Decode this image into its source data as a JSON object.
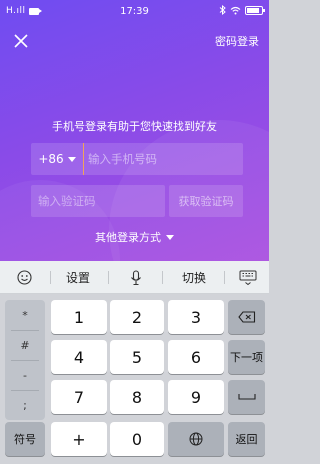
{
  "status_bar": {
    "signal": "H.ıll",
    "time": "17:39"
  },
  "header": {
    "password_login": "密码登录"
  },
  "login": {
    "hint": "手机号登录有助于您快速找到好友",
    "country_code": "+86",
    "phone_placeholder": "输入手机号码",
    "code_placeholder": "输入验证码",
    "get_code": "获取验证码",
    "other_login": "其他登录方式"
  },
  "toolbar": {
    "settings": "设置",
    "switch": "切换"
  },
  "keyboard": {
    "symbols": [
      "*",
      "#",
      "-",
      ";"
    ],
    "row1": [
      "1",
      "2",
      "3"
    ],
    "row2": [
      "4",
      "5",
      "6"
    ],
    "row3": [
      "7",
      "8",
      "9"
    ],
    "next_label": "下一项",
    "symbol_key": "符号",
    "plus": "+",
    "zero": "0",
    "return_label": "返回"
  },
  "colors": {
    "gradient_start": "#6f4cf1",
    "gradient_end": "#a94fe0",
    "cursor": "#f0a35a"
  }
}
